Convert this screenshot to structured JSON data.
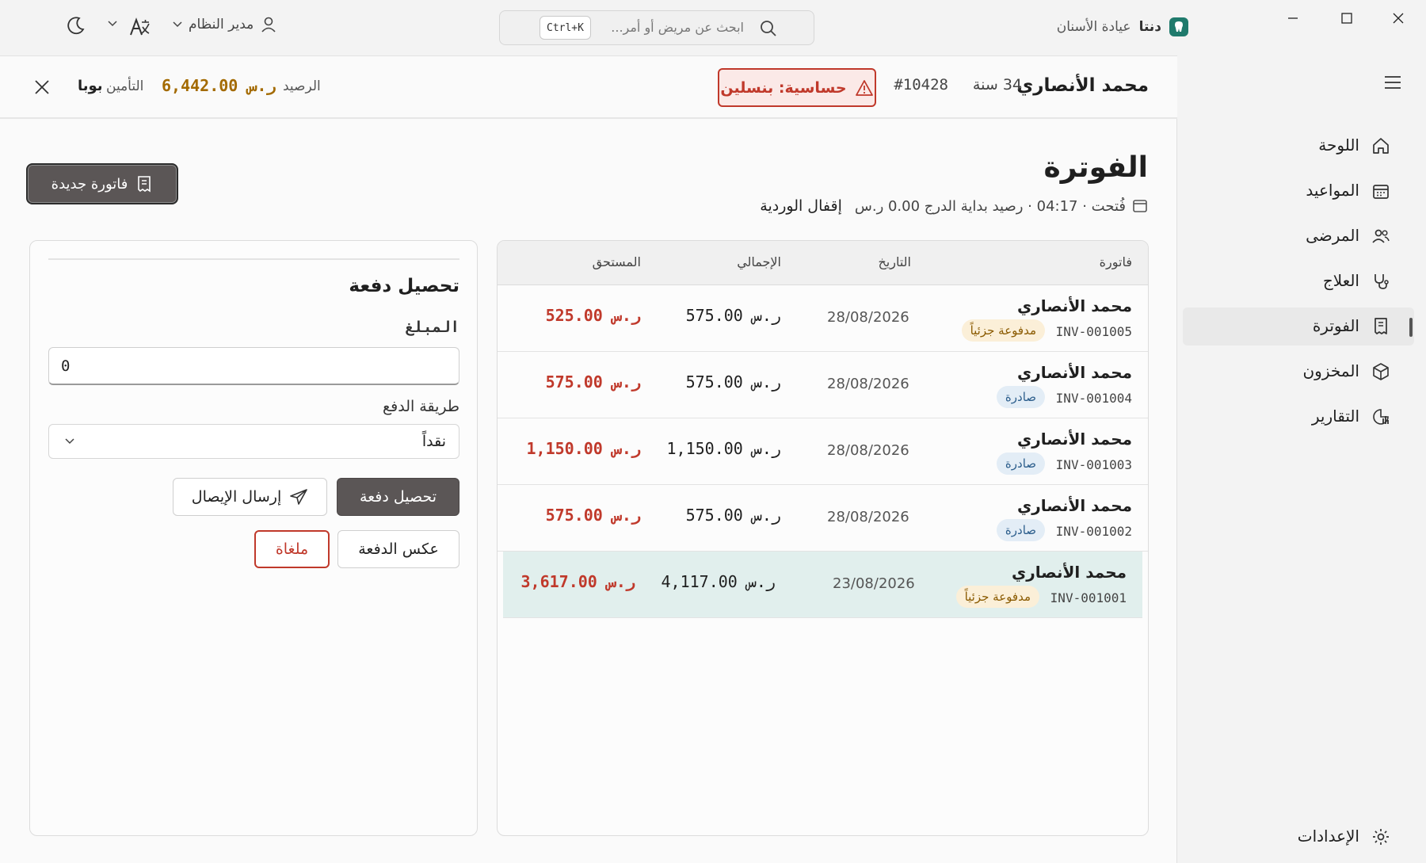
{
  "window": {
    "minimize_icon": "minimize-icon",
    "maximize_icon": "maximize-icon",
    "close_icon": "close-icon"
  },
  "brand": {
    "name": "دنتا",
    "subtitle": "عيادة الأسنان"
  },
  "search": {
    "placeholder": "ابحث عن مريض أو أمر...",
    "shortcut": "Ctrl+K"
  },
  "user": {
    "label": "مدير النظام"
  },
  "patient": {
    "name": "محمد الأنصاري",
    "age": "34 سنة",
    "id": "#10428",
    "allergy": "حساسية: بنسلين",
    "balance_label": "الرصيد",
    "balance_value": "6,442.00 ر.س",
    "insurance_label": "التأمين",
    "insurance_value": "بوبا"
  },
  "page": {
    "title": "الفوترة",
    "shift_info": "فُتحت · 04:17 · رصيد بداية الدرج 0.00 ر.س",
    "close_shift": "إقفال الوردية",
    "new_invoice": "فاتورة جديدة"
  },
  "table": {
    "headers": {
      "invoice": "فاتورة",
      "date": "التاريخ",
      "total": "الإجمالي",
      "due": "المستحق"
    },
    "rows": [
      {
        "name": "محمد الأنصاري",
        "number": "INV-001005",
        "status": "مدفوعة جزئياً",
        "status_kind": "partial",
        "date": "28/08/2026",
        "total": "575.00 ر.س",
        "due": "525.00 ر.س"
      },
      {
        "name": "محمد الأنصاري",
        "number": "INV-001004",
        "status": "صادرة",
        "status_kind": "issued",
        "date": "28/08/2026",
        "total": "575.00 ر.س",
        "due": "575.00 ر.س"
      },
      {
        "name": "محمد الأنصاري",
        "number": "INV-001003",
        "status": "صادرة",
        "status_kind": "issued",
        "date": "28/08/2026",
        "total": "1,150.00 ر.س",
        "due": "1,150.00 ر.س"
      },
      {
        "name": "محمد الأنصاري",
        "number": "INV-001002",
        "status": "صادرة",
        "status_kind": "issued",
        "date": "28/08/2026",
        "total": "575.00 ر.س",
        "due": "575.00 ر.س"
      },
      {
        "name": "محمد الأنصاري",
        "number": "INV-001001",
        "status": "مدفوعة جزئياً",
        "status_kind": "partial",
        "date": "23/08/2026",
        "total": "4,117.00 ر.س",
        "due": "3,617.00 ر.س"
      }
    ]
  },
  "payment": {
    "title": "تحصيل دفعة",
    "amount_label": "المبلغ",
    "amount_value": "0",
    "method_label": "طريقة الدفع",
    "method_value": "نقداً",
    "collect_button": "تحصيل دفعة",
    "send_receipt_button": "إرسال الإيصال",
    "reverse_button": "عكس الدفعة",
    "cancelled_button": "ملغاة"
  },
  "sidebar": {
    "items": [
      {
        "label": "اللوحة",
        "icon": "home-icon"
      },
      {
        "label": "المواعيد",
        "icon": "calendar-icon"
      },
      {
        "label": "المرضى",
        "icon": "users-icon"
      },
      {
        "label": "العلاج",
        "icon": "stethoscope-icon"
      },
      {
        "label": "الفوترة",
        "icon": "receipt-icon",
        "active": true
      },
      {
        "label": "المخزون",
        "icon": "box-icon"
      },
      {
        "label": "التقارير",
        "icon": "chart-icon"
      }
    ],
    "settings": "الإعدادات"
  },
  "colors": {
    "accent": "#1f7a6c",
    "danger": "#c0392b",
    "primary_button": "#5b5656",
    "partial_badge": "#fbefd8",
    "issued_badge": "#e3edf6"
  }
}
